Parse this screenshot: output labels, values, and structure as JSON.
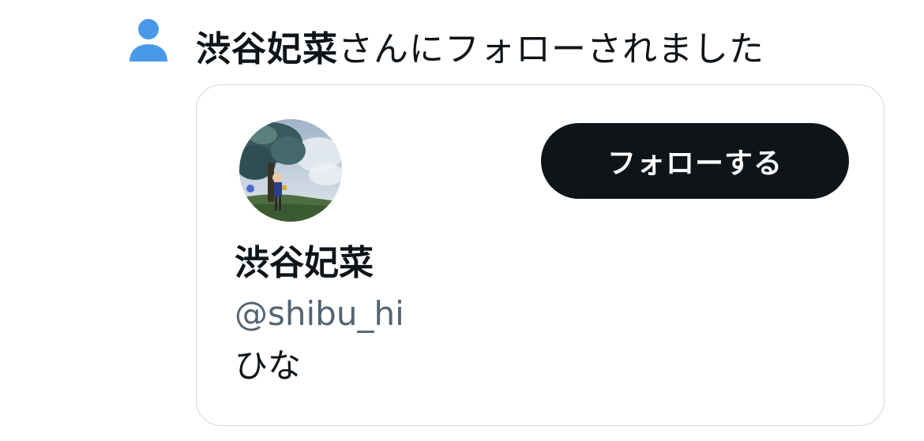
{
  "notification": {
    "icon": "person-icon",
    "icon_color": "#4a99e9",
    "follower_name": "渋谷妃菜",
    "message_suffix": "さんにフォローされました"
  },
  "user_card": {
    "display_name": "渋谷妃菜",
    "handle": "@shibu_hi",
    "bio": "ひな",
    "follow_button_label": "フォローする",
    "follow_button_color": "#0f1419",
    "handle_color": "#536471"
  }
}
